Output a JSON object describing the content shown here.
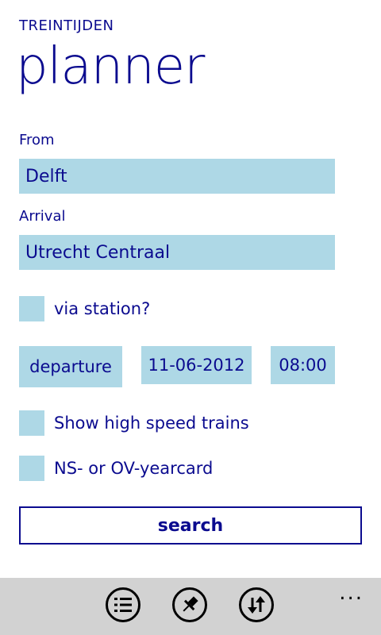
{
  "app": {
    "title": "TREINTIJDEN",
    "page": "planner"
  },
  "form": {
    "from_label": "From",
    "from_value": "Delft",
    "arrival_label": "Arrival",
    "arrival_value": "Utrecht Centraal",
    "via_label": "via station?",
    "mode_value": "departure",
    "date_value": "11-06-2012",
    "time_value": "08:00",
    "high_speed_label": "Show high speed trains",
    "yearcard_label": "NS- or OV-yearcard",
    "search_label": "search"
  },
  "appbar": {
    "buttons": [
      {
        "icon": "list-icon"
      },
      {
        "icon": "pin-icon"
      },
      {
        "icon": "swap-icon"
      }
    ],
    "more": "..."
  },
  "colors": {
    "accent": "#0b0b8f",
    "field_bg": "#aed8e6",
    "appbar_bg": "#d2d2d2"
  }
}
